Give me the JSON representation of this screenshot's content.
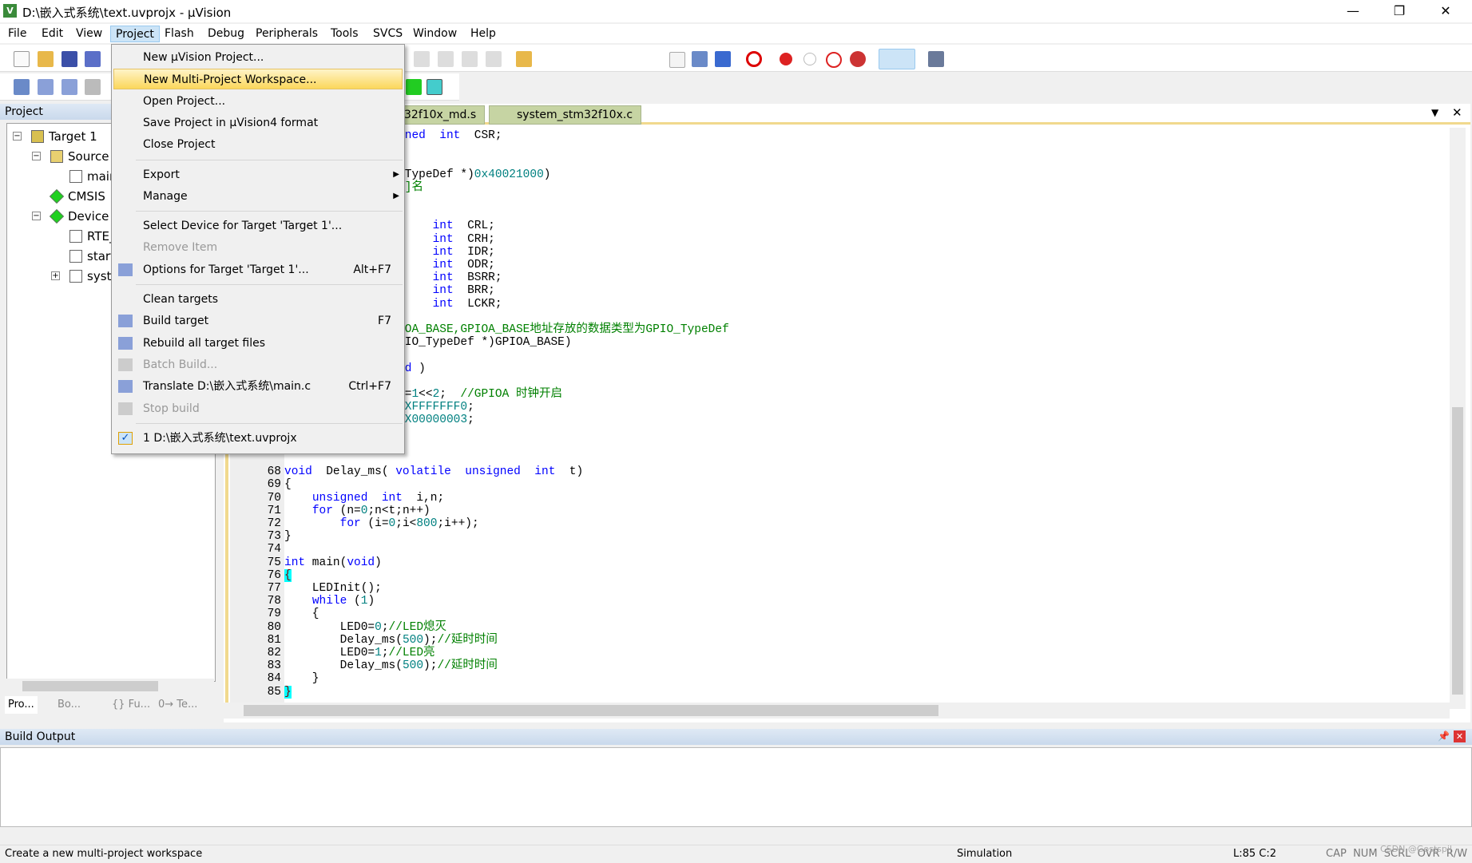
{
  "window": {
    "title": "D:\\嵌入式系统\\text.uvprojx - µVision",
    "app_icon": "V",
    "minimize": "—",
    "restore": "❐",
    "close": "✕"
  },
  "menubar": [
    "File",
    "Edit",
    "View",
    "Project",
    "Flash",
    "Debug",
    "Peripherals",
    "Tools",
    "SVCS",
    "Window",
    "Help"
  ],
  "project_panel": {
    "title": "Project",
    "tree": [
      {
        "label": "Target 1",
        "level": 0,
        "icon": "target-folder-icon",
        "expander": "⊟"
      },
      {
        "label": "Source G",
        "level": 1,
        "icon": "folder-icon",
        "expander": "⊟"
      },
      {
        "label": "main",
        "level": 2,
        "icon": "c-file-icon"
      },
      {
        "label": "CMSIS",
        "level": 1,
        "icon": "component-icon"
      },
      {
        "label": "Device",
        "level": 1,
        "icon": "component-icon",
        "expander": "⊟"
      },
      {
        "label": "RTE_",
        "level": 2,
        "icon": "file-icon"
      },
      {
        "label": "startu",
        "level": 2,
        "icon": "c-file-icon"
      },
      {
        "label": "syste",
        "level": 2,
        "icon": "c-file-icon",
        "expander": "⊞"
      }
    ],
    "tabs": [
      "Pro...",
      "Bo...",
      "{} Fu...",
      "0→ Te..."
    ]
  },
  "editor": {
    "tabs": [
      "32f10x_md.s",
      "system_stm32f10x.c"
    ],
    "lines": [
      {
        "n": 42,
        "partial": true,
        "s": [
          [
            "kw",
            "ned  int"
          ],
          [
            "",
            "  CSR;"
          ]
        ]
      },
      {
        "n": 45,
        "partial": true,
        "s": [
          [
            "",
            "TypeDef *)"
          ],
          [
            "num",
            "0x40021000"
          ],
          [
            "",
            ")"
          ]
        ]
      },
      {
        "n": 46,
        "partial": true,
        "s": [
          [
            "cm",
            "]名"
          ]
        ]
      },
      {
        "n": 49,
        "partial": true,
        "s": [
          [
            "",
            "    "
          ],
          [
            "kw",
            "int"
          ],
          [
            "",
            "  CRL;"
          ]
        ]
      },
      {
        "n": 50,
        "partial": true,
        "s": [
          [
            "",
            "    "
          ],
          [
            "kw",
            "int"
          ],
          [
            "",
            "  CRH;"
          ]
        ]
      },
      {
        "n": 51,
        "partial": true,
        "s": [
          [
            "",
            "    "
          ],
          [
            "kw",
            "int"
          ],
          [
            "",
            "  IDR;"
          ]
        ]
      },
      {
        "n": 52,
        "partial": true,
        "s": [
          [
            "",
            "    "
          ],
          [
            "kw",
            "int"
          ],
          [
            "",
            "  ODR;"
          ]
        ]
      },
      {
        "n": 53,
        "partial": true,
        "s": [
          [
            "",
            "    "
          ],
          [
            "kw",
            "int"
          ],
          [
            "",
            "  BSRR;"
          ]
        ]
      },
      {
        "n": 54,
        "partial": true,
        "s": [
          [
            "",
            "    "
          ],
          [
            "kw",
            "int"
          ],
          [
            "",
            "  BRR;"
          ]
        ]
      },
      {
        "n": 55,
        "partial": true,
        "s": [
          [
            "",
            "    "
          ],
          [
            "kw",
            "int"
          ],
          [
            "",
            "  LCKR;"
          ]
        ]
      },
      {
        "n": 57,
        "partial": true,
        "s": [
          [
            "cm",
            "OA_BASE,GPIOA_BASE地址存放的数据类型为GPIO_TypeDef"
          ]
        ]
      },
      {
        "n": 58,
        "partial": true,
        "s": [
          [
            "",
            "IO_TypeDef *)GPIOA_BASE)"
          ]
        ]
      },
      {
        "n": 60,
        "partial": true,
        "s": [
          [
            "kw",
            "d"
          ],
          [
            "",
            " )"
          ]
        ]
      },
      {
        "n": 62,
        "partial": true,
        "s": [
          [
            "",
            "="
          ],
          [
            "num",
            "1"
          ],
          [
            "",
            "<<"
          ],
          [
            "num",
            "2"
          ],
          [
            "",
            ";  "
          ],
          [
            "cm",
            "//GPIOA 时钟开启"
          ]
        ]
      },
      {
        "n": 63,
        "partial": true,
        "s": [
          [
            "num",
            "XFFFFFFF0"
          ],
          [
            "",
            ";"
          ]
        ]
      },
      {
        "n": 64,
        "partial": true,
        "s": [
          [
            "num",
            "X00000003"
          ],
          [
            "",
            ";"
          ]
        ]
      },
      {
        "n": 68,
        "s": [
          [
            "kw",
            "void"
          ],
          [
            "",
            "  Delay_ms( "
          ],
          [
            "kw",
            "volatile"
          ],
          [
            "",
            "  "
          ],
          [
            "kw",
            "unsigned"
          ],
          [
            "",
            "  "
          ],
          [
            "kw",
            "int"
          ],
          [
            "",
            "  t)"
          ]
        ]
      },
      {
        "n": 69,
        "s": [
          [
            "",
            "{"
          ]
        ]
      },
      {
        "n": 70,
        "s": [
          [
            "",
            "    "
          ],
          [
            "kw",
            "unsigned"
          ],
          [
            "",
            "  "
          ],
          [
            "kw",
            "int"
          ],
          [
            "",
            "  i,n;"
          ]
        ]
      },
      {
        "n": 71,
        "s": [
          [
            "",
            "    "
          ],
          [
            "kw",
            "for"
          ],
          [
            "",
            " (n="
          ],
          [
            "num",
            "0"
          ],
          [
            "",
            ";n<t;n++)"
          ]
        ]
      },
      {
        "n": 72,
        "s": [
          [
            "",
            "        "
          ],
          [
            "kw",
            "for"
          ],
          [
            "",
            " (i="
          ],
          [
            "num",
            "0"
          ],
          [
            "",
            ";i<"
          ],
          [
            "num",
            "800"
          ],
          [
            "",
            ";i++);"
          ]
        ]
      },
      {
        "n": 73,
        "s": [
          [
            "",
            "}"
          ]
        ]
      },
      {
        "n": 74,
        "s": []
      },
      {
        "n": 75,
        "s": [
          [
            "kw",
            "int"
          ],
          [
            "",
            " main("
          ],
          [
            "kw",
            "void"
          ],
          [
            "",
            ")"
          ]
        ]
      },
      {
        "n": 76,
        "s": [
          [
            "br",
            "{"
          ]
        ]
      },
      {
        "n": 77,
        "s": [
          [
            "",
            "    LEDInit();"
          ]
        ]
      },
      {
        "n": 78,
        "s": [
          [
            "",
            "    "
          ],
          [
            "kw",
            "while"
          ],
          [
            "",
            " ("
          ],
          [
            "num",
            "1"
          ],
          [
            "",
            ")"
          ]
        ]
      },
      {
        "n": 79,
        "s": [
          [
            "",
            "    {"
          ]
        ]
      },
      {
        "n": 80,
        "s": [
          [
            "",
            "        LED0="
          ],
          [
            "num",
            "0"
          ],
          [
            "",
            ";"
          ],
          [
            "cm",
            "//LED熄灭"
          ]
        ]
      },
      {
        "n": 81,
        "s": [
          [
            "",
            "        Delay_ms("
          ],
          [
            "num",
            "500"
          ],
          [
            "",
            ");"
          ],
          [
            "cm",
            "//延时时间"
          ]
        ]
      },
      {
        "n": 82,
        "s": [
          [
            "",
            "        LED0="
          ],
          [
            "num",
            "1"
          ],
          [
            "",
            ";"
          ],
          [
            "cm",
            "//LED亮"
          ]
        ]
      },
      {
        "n": 83,
        "s": [
          [
            "",
            "        Delay_ms("
          ],
          [
            "num",
            "500"
          ],
          [
            "",
            ");"
          ],
          [
            "cm",
            "//延时时间"
          ]
        ]
      },
      {
        "n": 84,
        "s": [
          [
            "",
            "    }"
          ]
        ]
      },
      {
        "n": 85,
        "s": [
          [
            "br",
            "}"
          ]
        ]
      }
    ]
  },
  "project_menu": {
    "items": [
      {
        "label": "New µVision Project..."
      },
      {
        "label": "New Multi-Project Workspace...",
        "highlighted": true
      },
      {
        "label": "Open Project..."
      },
      {
        "label": "Save Project in µVision4 format"
      },
      {
        "label": "Close Project",
        "sep_after": true
      },
      {
        "label": "Export",
        "submenu": true
      },
      {
        "label": "Manage",
        "submenu": true,
        "sep_after": true
      },
      {
        "label": "Select Device for Target 'Target 1'..."
      },
      {
        "label": "Remove Item",
        "disabled": true
      },
      {
        "label": "Options for Target 'Target 1'...",
        "shortcut": "Alt+F7",
        "icon": "magic-wand-icon",
        "sep_after": true
      },
      {
        "label": "Clean targets"
      },
      {
        "label": "Build target",
        "shortcut": "F7",
        "icon": "build-icon"
      },
      {
        "label": "Rebuild all target files",
        "icon": "rebuild-icon"
      },
      {
        "label": "Batch Build...",
        "disabled": true,
        "icon": "batch-build-icon"
      },
      {
        "label": "Translate D:\\嵌入式系统\\main.c",
        "shortcut": "Ctrl+F7",
        "icon": "translate-icon"
      },
      {
        "label": "Stop build",
        "disabled": true,
        "icon": "stop-build-icon",
        "sep_after": true
      },
      {
        "label": "1 D:\\嵌入式系统\\text.uvprojx",
        "checked": true,
        "icon": "check-icon"
      }
    ]
  },
  "build_output": {
    "title": "Build Output"
  },
  "statusbar": {
    "message": "Create a new multi-project workspace",
    "mode": "Simulation",
    "position": "L:85 C:2",
    "flags": "CAP  NUM  SCRL  OVR  R/W",
    "watermark": "CSDN @Gostspil"
  },
  "colors": {
    "keyword": "#0000ff",
    "number": "#008080",
    "comment": "#008000",
    "highlight": "#fbd75b"
  }
}
